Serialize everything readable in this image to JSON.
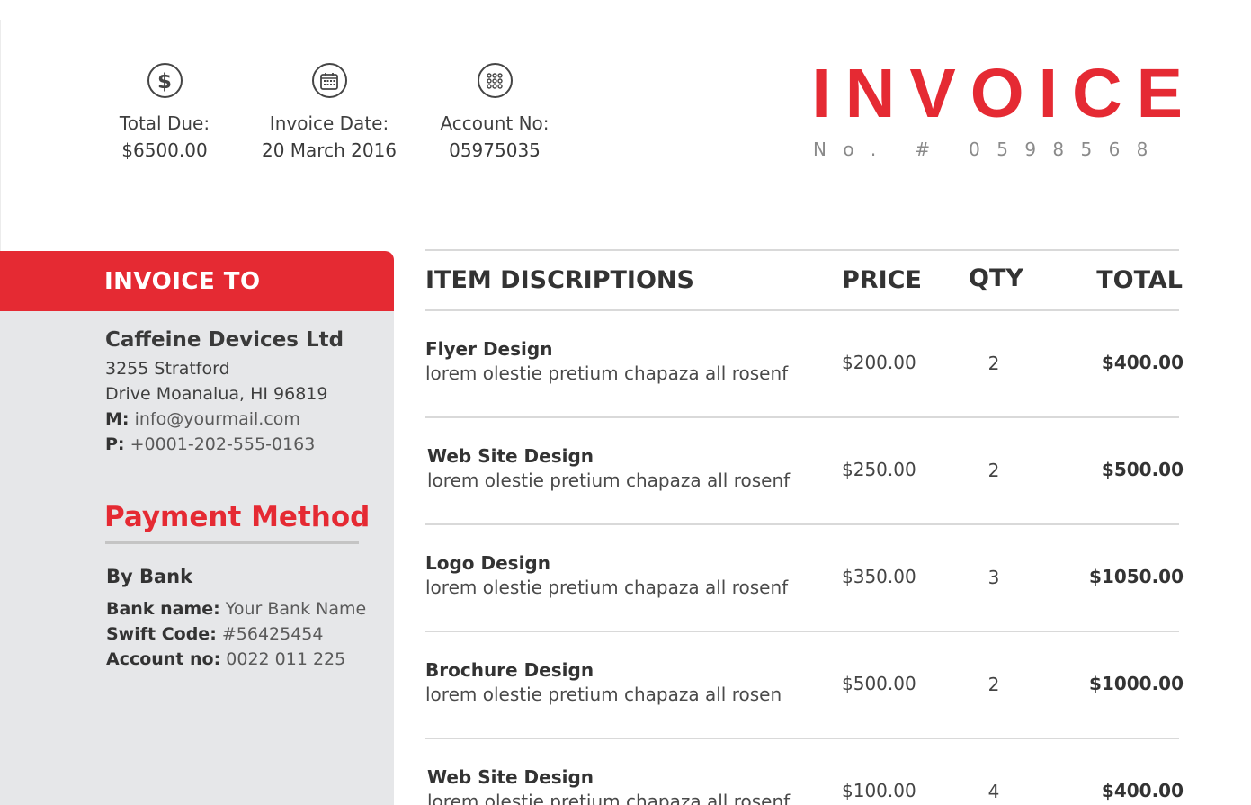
{
  "summary": [
    {
      "icon": "dollar-icon",
      "label": "Total Due:",
      "value": "$6500.00"
    },
    {
      "icon": "calendar-icon",
      "label": "Invoice Date:",
      "value": "20 March 2016"
    },
    {
      "icon": "keypad-icon",
      "label": "Account No:",
      "value": "05975035"
    }
  ],
  "header": {
    "title": "INVOICE",
    "number": "N o .   #   0 5 9 8 5 6 8"
  },
  "invoice_to": {
    "heading": "INVOICE TO",
    "company": "Caffeine Devices Ltd",
    "address_line1": "3255 Stratford",
    "address_line2": "Drive Moanalua, HI 96819",
    "mail_label": "M:",
    "mail": "info@yourmail.com",
    "phone_label": "P:",
    "phone": "+0001-202-555-0163"
  },
  "payment": {
    "title": "Payment Method",
    "method": "By Bank",
    "bank_name_label": "Bank name:",
    "bank_name": "Your Bank Name",
    "swift_label": "Swift Code:",
    "swift": "#56425454",
    "account_label": "Account no:",
    "account": "0022 011 225"
  },
  "table": {
    "headers": {
      "description": "ITEM DISCRIPTIONS",
      "price": "PRICE",
      "qty": "QTY",
      "total": "TOTAL"
    },
    "rows": [
      {
        "title": "Flyer Design",
        "desc": "lorem olestie pretium chapaza all rosenf",
        "price": "$200.00",
        "qty": "2",
        "total": "$400.00"
      },
      {
        "title": "Web Site Design",
        "desc": "lorem olestie pretium chapaza all rosenf",
        "price": "$250.00",
        "qty": "2",
        "total": "$500.00"
      },
      {
        "title": "Logo Design",
        "desc": "lorem olestie pretium chapaza all rosenf",
        "price": "$350.00",
        "qty": "3",
        "total": "$1050.00"
      },
      {
        "title": "Brochure Design",
        "desc": "lorem olestie pretium chapaza all rosen",
        "price": "$500.00",
        "qty": "2",
        "total": "$1000.00"
      },
      {
        "title": "Web Site Design",
        "desc": "lorem olestie pretium chapaza all rosenf",
        "price": "$100.00",
        "qty": "4",
        "total": "$400.00"
      }
    ]
  },
  "colors": {
    "accent": "#e52a33",
    "sidebar_bg": "#e6e7e9",
    "text": "#3a3a3a"
  }
}
